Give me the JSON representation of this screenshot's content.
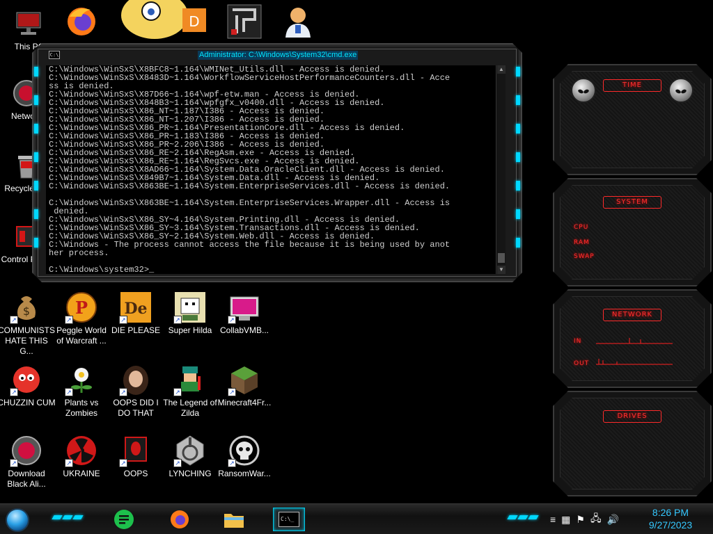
{
  "console": {
    "title": "Administrator: C:\\Windows\\System32\\cmd.exe",
    "icon_text": "C:\\",
    "lines": [
      "C:\\Windows\\WinSxS\\X8BFC8~1.164\\WMINet_Utils.dll - Access is denied.",
      "C:\\Windows\\WinSxS\\X8483D~1.164\\WorkflowServiceHostPerformanceCounters.dll - Acce",
      "ss is denied.",
      "C:\\Windows\\WinSxS\\X87D66~1.164\\wpf-etw.man - Access is denied.",
      "C:\\Windows\\WinSxS\\X848B3~1.164\\wpfgfx_v0400.dll - Access is denied.",
      "C:\\Windows\\WinSxS\\X86_NT~1.187\\I386 - Access is denied.",
      "C:\\Windows\\WinSxS\\X86_NT~1.207\\I386 - Access is denied.",
      "C:\\Windows\\WinSxS\\X86_PR~1.164\\PresentationCore.dll - Access is denied.",
      "C:\\Windows\\WinSxS\\X86_PR~1.183\\I386 - Access is denied.",
      "C:\\Windows\\WinSxS\\X86_PR~2.206\\I386 - Access is denied.",
      "C:\\Windows\\WinSxS\\X86_RE~2.164\\RegAsm.exe - Access is denied.",
      "C:\\Windows\\WinSxS\\X86_RE~1.164\\RegSvcs.exe - Access is denied.",
      "C:\\Windows\\WinSxS\\X8AD66~1.164\\System.Data.OracleClient.dll - Access is denied.",
      "C:\\Windows\\WinSxS\\X849B7~1.164\\System.Data.dll - Access is denied.",
      "C:\\Windows\\WinSxS\\X863BE~1.164\\System.EnterpriseServices.dll - Access is denied.",
      "",
      "C:\\Windows\\WinSxS\\X863BE~1.164\\System.EnterpriseServices.Wrapper.dll - Access is",
      " denied.",
      "C:\\Windows\\WinSxS\\X86_SY~4.164\\System.Printing.dll - Access is denied.",
      "C:\\Windows\\WinSxS\\X86_SY~3.164\\System.Transactions.dll - Access is denied.",
      "C:\\Windows\\WinSxS\\X86_SY~2.164\\System.Web.dll - Access is denied.",
      "C:\\Windows - The process cannot access the file because it is being used by anot",
      "her process.",
      "",
      "C:\\Windows\\system32>_"
    ]
  },
  "desktop_icons": [
    {
      "label": "This PC",
      "icon": "computer-icon"
    },
    {
      "label": "Network",
      "icon": "network-icon"
    },
    {
      "label": "Recycle Bin",
      "icon": "recycle-bin-icon"
    },
    {
      "label": "Control Panel",
      "icon": "control-panel-icon"
    },
    {
      "label": "COMMUNISTS HATE THIS G...",
      "icon": "money-bag-icon"
    },
    {
      "label": "Peggle World of Warcraft ...",
      "icon": "peggle-icon"
    },
    {
      "label": "DIE PLEASE",
      "icon": "die-icon",
      "glyph": "De"
    },
    {
      "label": "Super Hilda",
      "icon": "super-hilda-icon"
    },
    {
      "label": "CollabVMB...",
      "icon": "collabvm-icon"
    },
    {
      "label": "CHUZZIN CUM",
      "icon": "chuzzle-icon"
    },
    {
      "label": "Plants vs Zombies",
      "icon": "plants-vs-zombies-icon"
    },
    {
      "label": "OOPS DID I DO THAT",
      "icon": "portrait-icon"
    },
    {
      "label": "The Legend of Zilda",
      "icon": "legend-of-zilda-icon"
    },
    {
      "label": "Minecraft4Fr...",
      "icon": "minecraft-icon"
    },
    {
      "label": "Download Black Ali...",
      "icon": "alien-orb-icon"
    },
    {
      "label": "UKRAINE",
      "icon": "radiation-icon"
    },
    {
      "label": "OOPS",
      "icon": "alienware-icon"
    },
    {
      "label": "LYNCHING",
      "icon": "lynching-icon"
    },
    {
      "label": "RansomWar...",
      "icon": "skull-icon"
    }
  ],
  "gadgets": {
    "time": {
      "title": "TIME"
    },
    "system": {
      "title": "SYSTEM",
      "rows": [
        "CPU",
        "RAM",
        "SWAP"
      ]
    },
    "network": {
      "title": "NETWORK",
      "rows": [
        "IN",
        "OUT"
      ]
    },
    "drives": {
      "title": "DRIVES"
    }
  },
  "taskbar": {
    "time": "8:26 PM",
    "date": "9/27/2023",
    "console_button_text": "C:\\_"
  },
  "colors": {
    "accent_cyan": "#00d8ff",
    "accent_red": "#ff3030",
    "clock_blue": "#35c8ff"
  }
}
